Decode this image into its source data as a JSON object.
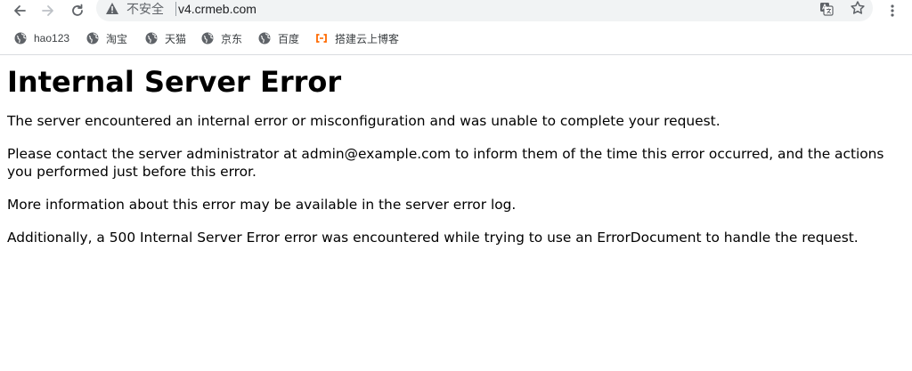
{
  "browser": {
    "insecure_label": "不安全",
    "url": "v4.crmeb.com",
    "bookmarks": [
      {
        "label": "hao123"
      },
      {
        "label": "淘宝"
      },
      {
        "label": "天猫"
      },
      {
        "label": "京东"
      },
      {
        "label": "百度"
      },
      {
        "label": "搭建云上博客"
      }
    ]
  },
  "page": {
    "title": "Internal Server Error",
    "paragraphs": [
      "The server encountered an internal error or misconfiguration and was unable to complete your request.",
      "Please contact the server administrator at admin@example.com to inform them of the time this error occurred, and the actions you performed just before this error.",
      "More information about this error may be available in the server error log.",
      "Additionally, a 500 Internal Server Error error was encountered while trying to use an ErrorDocument to handle the request."
    ]
  },
  "colors": {
    "toolbar_icon": "#5f6368",
    "omnibox_bg": "#f1f3f4",
    "cloud_bookmark": "#ff6a00"
  }
}
